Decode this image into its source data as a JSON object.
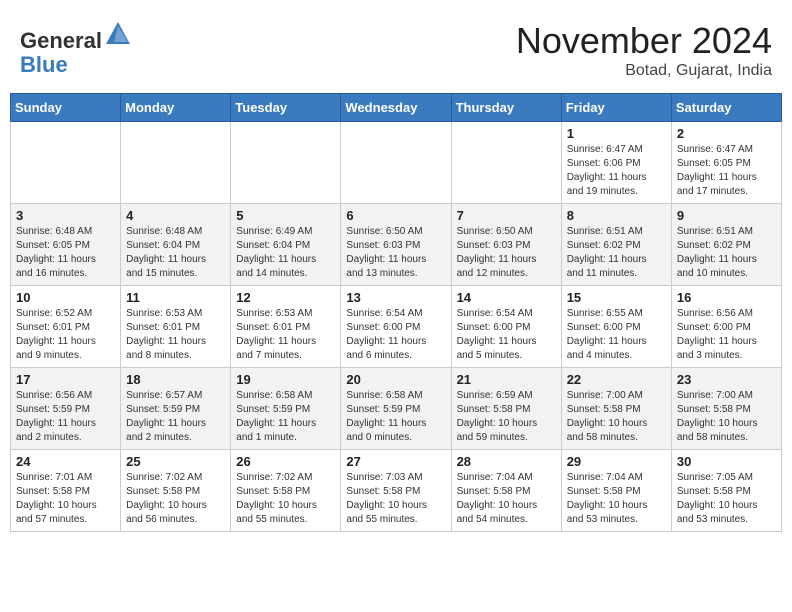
{
  "header": {
    "logo_line1": "General",
    "logo_line2": "Blue",
    "month": "November 2024",
    "location": "Botad, Gujarat, India"
  },
  "days_of_week": [
    "Sunday",
    "Monday",
    "Tuesday",
    "Wednesday",
    "Thursday",
    "Friday",
    "Saturday"
  ],
  "weeks": [
    [
      {
        "day": "",
        "info": ""
      },
      {
        "day": "",
        "info": ""
      },
      {
        "day": "",
        "info": ""
      },
      {
        "day": "",
        "info": ""
      },
      {
        "day": "",
        "info": ""
      },
      {
        "day": "1",
        "info": "Sunrise: 6:47 AM\nSunset: 6:06 PM\nDaylight: 11 hours\nand 19 minutes."
      },
      {
        "day": "2",
        "info": "Sunrise: 6:47 AM\nSunset: 6:05 PM\nDaylight: 11 hours\nand 17 minutes."
      }
    ],
    [
      {
        "day": "3",
        "info": "Sunrise: 6:48 AM\nSunset: 6:05 PM\nDaylight: 11 hours\nand 16 minutes."
      },
      {
        "day": "4",
        "info": "Sunrise: 6:48 AM\nSunset: 6:04 PM\nDaylight: 11 hours\nand 15 minutes."
      },
      {
        "day": "5",
        "info": "Sunrise: 6:49 AM\nSunset: 6:04 PM\nDaylight: 11 hours\nand 14 minutes."
      },
      {
        "day": "6",
        "info": "Sunrise: 6:50 AM\nSunset: 6:03 PM\nDaylight: 11 hours\nand 13 minutes."
      },
      {
        "day": "7",
        "info": "Sunrise: 6:50 AM\nSunset: 6:03 PM\nDaylight: 11 hours\nand 12 minutes."
      },
      {
        "day": "8",
        "info": "Sunrise: 6:51 AM\nSunset: 6:02 PM\nDaylight: 11 hours\nand 11 minutes."
      },
      {
        "day": "9",
        "info": "Sunrise: 6:51 AM\nSunset: 6:02 PM\nDaylight: 11 hours\nand 10 minutes."
      }
    ],
    [
      {
        "day": "10",
        "info": "Sunrise: 6:52 AM\nSunset: 6:01 PM\nDaylight: 11 hours\nand 9 minutes."
      },
      {
        "day": "11",
        "info": "Sunrise: 6:53 AM\nSunset: 6:01 PM\nDaylight: 11 hours\nand 8 minutes."
      },
      {
        "day": "12",
        "info": "Sunrise: 6:53 AM\nSunset: 6:01 PM\nDaylight: 11 hours\nand 7 minutes."
      },
      {
        "day": "13",
        "info": "Sunrise: 6:54 AM\nSunset: 6:00 PM\nDaylight: 11 hours\nand 6 minutes."
      },
      {
        "day": "14",
        "info": "Sunrise: 6:54 AM\nSunset: 6:00 PM\nDaylight: 11 hours\nand 5 minutes."
      },
      {
        "day": "15",
        "info": "Sunrise: 6:55 AM\nSunset: 6:00 PM\nDaylight: 11 hours\nand 4 minutes."
      },
      {
        "day": "16",
        "info": "Sunrise: 6:56 AM\nSunset: 6:00 PM\nDaylight: 11 hours\nand 3 minutes."
      }
    ],
    [
      {
        "day": "17",
        "info": "Sunrise: 6:56 AM\nSunset: 5:59 PM\nDaylight: 11 hours\nand 2 minutes."
      },
      {
        "day": "18",
        "info": "Sunrise: 6:57 AM\nSunset: 5:59 PM\nDaylight: 11 hours\nand 2 minutes."
      },
      {
        "day": "19",
        "info": "Sunrise: 6:58 AM\nSunset: 5:59 PM\nDaylight: 11 hours\nand 1 minute."
      },
      {
        "day": "20",
        "info": "Sunrise: 6:58 AM\nSunset: 5:59 PM\nDaylight: 11 hours\nand 0 minutes."
      },
      {
        "day": "21",
        "info": "Sunrise: 6:59 AM\nSunset: 5:58 PM\nDaylight: 10 hours\nand 59 minutes."
      },
      {
        "day": "22",
        "info": "Sunrise: 7:00 AM\nSunset: 5:58 PM\nDaylight: 10 hours\nand 58 minutes."
      },
      {
        "day": "23",
        "info": "Sunrise: 7:00 AM\nSunset: 5:58 PM\nDaylight: 10 hours\nand 58 minutes."
      }
    ],
    [
      {
        "day": "24",
        "info": "Sunrise: 7:01 AM\nSunset: 5:58 PM\nDaylight: 10 hours\nand 57 minutes."
      },
      {
        "day": "25",
        "info": "Sunrise: 7:02 AM\nSunset: 5:58 PM\nDaylight: 10 hours\nand 56 minutes."
      },
      {
        "day": "26",
        "info": "Sunrise: 7:02 AM\nSunset: 5:58 PM\nDaylight: 10 hours\nand 55 minutes."
      },
      {
        "day": "27",
        "info": "Sunrise: 7:03 AM\nSunset: 5:58 PM\nDaylight: 10 hours\nand 55 minutes."
      },
      {
        "day": "28",
        "info": "Sunrise: 7:04 AM\nSunset: 5:58 PM\nDaylight: 10 hours\nand 54 minutes."
      },
      {
        "day": "29",
        "info": "Sunrise: 7:04 AM\nSunset: 5:58 PM\nDaylight: 10 hours\nand 53 minutes."
      },
      {
        "day": "30",
        "info": "Sunrise: 7:05 AM\nSunset: 5:58 PM\nDaylight: 10 hours\nand 53 minutes."
      }
    ]
  ]
}
